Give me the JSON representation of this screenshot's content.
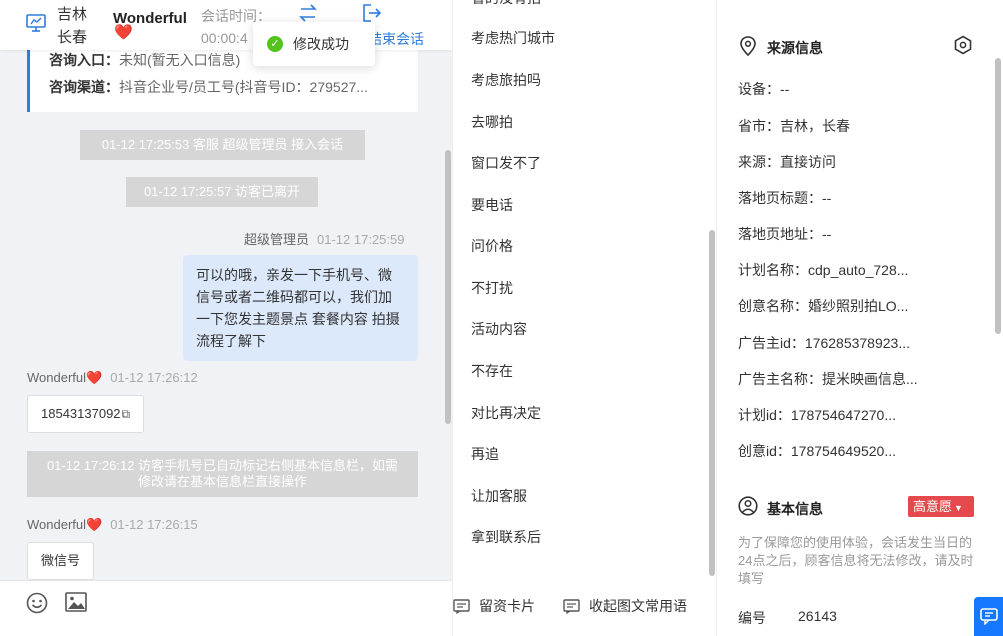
{
  "header": {
    "location_province": "吉林",
    "location_city": "长春",
    "visitor_name": "Wonderful",
    "visitor_heart": "❤️",
    "session_time_label": "会话时间：",
    "session_time_value": "00:00:4",
    "end_session_label": "结束会话",
    "icons": [
      "monitor-icon",
      "transfer-icon",
      "exit-icon"
    ]
  },
  "toast": {
    "text": "修改成功",
    "icon": "check-circle-icon",
    "color": "#52c41a"
  },
  "consult_card": {
    "entry_label": "咨询入口：",
    "entry_value": "未知(暂无入口信息)",
    "channel_label": "咨询渠道：",
    "channel_value": "抖音企业号/员工号(抖音号ID：279527..."
  },
  "messages": {
    "sys1": "01-12 17:25:53 客服 超级管理员 接入会话",
    "sys2": "01-12 17:25:57 访客已离开",
    "agent_name": "超级管理员",
    "agent_time": "01-12 17:25:59",
    "agent_text": "可以的哦，亲发一下手机号、微信号或者二维码都可以，我们加一下您发主题景点 套餐内容 拍摄流程了解下",
    "visitor1_name": "Wonderful",
    "visitor1_time": "01-12 17:26:12",
    "visitor1_text": "18543137092",
    "sys3": "01-12 17:26:12 访客手机号已自动标记右侧基本信息栏，如需修改请在基本信息栏直接操作",
    "visitor2_name": "Wonderful",
    "visitor2_time": "01-12 17:26:15",
    "visitor2_text": "微信号",
    "heart": "❤️"
  },
  "chat_footer": {
    "icons": [
      "emoji-icon",
      "image-icon"
    ]
  },
  "quick_replies": {
    "top_partial": "省的没有拍",
    "items": [
      "考虑热门城市",
      "考虑旅拍吗",
      "去哪拍",
      "窗口发不了",
      "要电话",
      "问价格",
      "不打扰",
      "活动内容",
      "不存在",
      "对比再决定",
      "再追",
      "让加客服",
      "拿到联系后"
    ],
    "footer_card": "留资卡片",
    "footer_collapse": "收起图文常用语"
  },
  "source_info": {
    "title": "来源信息",
    "fields": [
      "设备：--",
      "省市：吉林，长春",
      "来源：直接访问",
      "落地页标题：--",
      "落地页地址：--",
      "计划名称：cdp_auto_728...",
      "创意名称：婚纱照别拍LO...",
      "广告主id：176285378923...",
      "广告主名称：提米映画信息...",
      "计划id：178754647270...",
      "创意id：178754649520..."
    ]
  },
  "basic_info": {
    "title": "基本信息",
    "intent_badge": "高意愿",
    "intent_color": "#e5484d",
    "notice": "为了保障您的使用体验，会话发生当日的24点之后，顾客信息将无法修改，请及时填写",
    "id_label": "编号",
    "id_value": "26143"
  },
  "colors": {
    "accent": "#2f7dde",
    "bubble_agent": "#dce9fb",
    "system_msg": "#d6d6d6"
  }
}
